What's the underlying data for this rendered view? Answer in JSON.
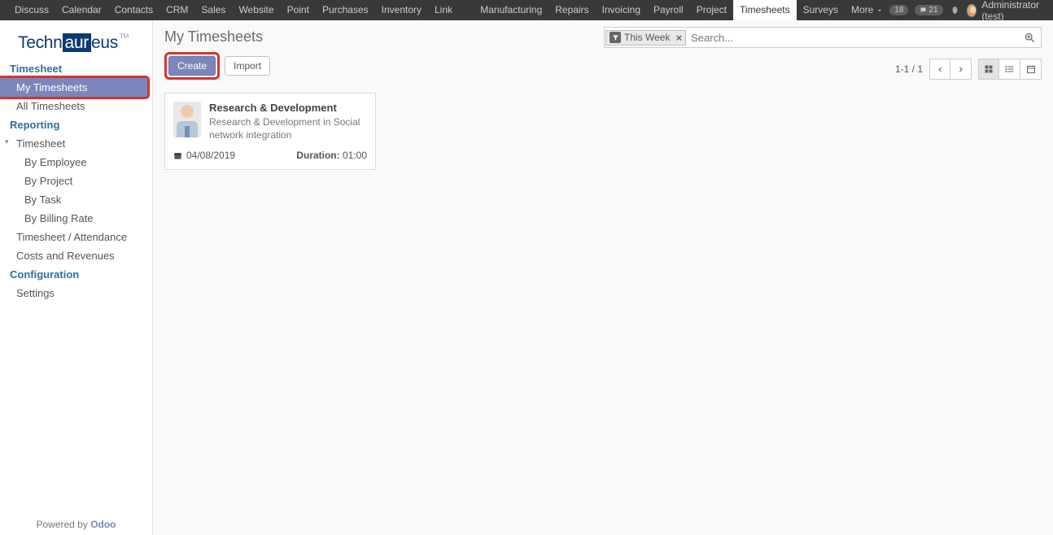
{
  "topnav": {
    "items": [
      "Discuss",
      "Calendar",
      "Contacts",
      "CRM",
      "Sales",
      "Website",
      "Point of Sale",
      "Purchases",
      "Inventory",
      "Link Tracker",
      "Manufacturing",
      "Repairs",
      "Invoicing",
      "Payroll",
      "Project",
      "Timesheets",
      "Surveys"
    ],
    "more_label": "More",
    "active_index": 15,
    "badge1": "18",
    "badge2": "21",
    "user_name": "Administrator (test)"
  },
  "logo": {
    "part1": "Techn",
    "part2": "aur",
    "part3": "eus",
    "tm": "TM"
  },
  "sidebar": {
    "sections": [
      {
        "header": "Timesheet",
        "items": [
          {
            "label": "My Timesheets",
            "active": true
          },
          {
            "label": "All Timesheets"
          }
        ]
      },
      {
        "header": "Reporting",
        "items": [
          {
            "label": "Timesheet",
            "collapsible": true
          },
          {
            "label": "By Employee",
            "sub": true
          },
          {
            "label": "By Project",
            "sub": true
          },
          {
            "label": "By Task",
            "sub": true
          },
          {
            "label": "By Billing Rate",
            "sub": true
          },
          {
            "label": "Timesheet / Attendance"
          },
          {
            "label": "Costs and Revenues"
          }
        ]
      },
      {
        "header": "Configuration",
        "items": [
          {
            "label": "Settings"
          }
        ]
      }
    ],
    "footer_prefix": "Powered by ",
    "footer_link": "Odoo"
  },
  "view": {
    "title": "My Timesheets",
    "create_label": "Create",
    "import_label": "Import",
    "filter_label": "This Week",
    "search_placeholder": "Search...",
    "pager": "1-1 / 1"
  },
  "card": {
    "title": "Research & Development",
    "subtitle": "Research & Development in Social network integration",
    "date": "04/08/2019",
    "duration_label": "Duration:",
    "duration_value": "01:00"
  }
}
